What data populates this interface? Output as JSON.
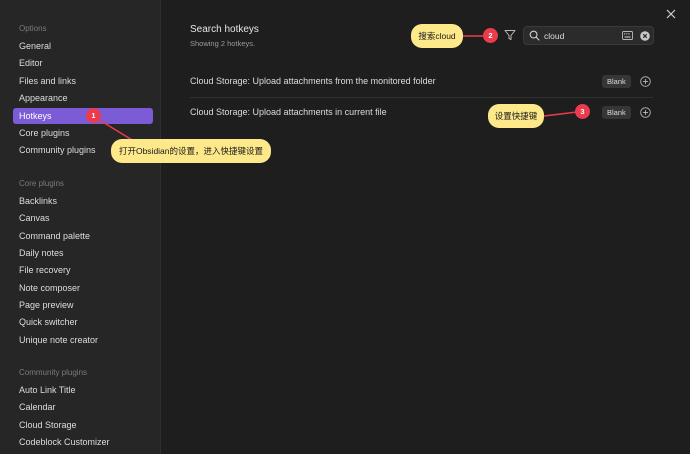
{
  "sidebar": {
    "sections": [
      {
        "title": "Options",
        "items": [
          "General",
          "Editor",
          "Files and links",
          "Appearance",
          "Hotkeys",
          "Core plugins",
          "Community plugins"
        ]
      },
      {
        "title": "Core plugins",
        "items": [
          "Backlinks",
          "Canvas",
          "Command palette",
          "Daily notes",
          "File recovery",
          "Note composer",
          "Page preview",
          "Quick switcher",
          "Unique note creator"
        ]
      },
      {
        "title": "Community plugins",
        "items": [
          "Auto Link Title",
          "Calendar",
          "Cloud Storage",
          "Codeblock Customizer"
        ]
      }
    ],
    "active_item": "Hotkeys"
  },
  "main": {
    "title": "Search hotkeys",
    "subtitle": "Showing 2 hotkeys.",
    "search": {
      "value": "cloud"
    },
    "rows": [
      {
        "label": "Cloud Storage: Upload attachments from the monitored folder",
        "hotkey": "Blank"
      },
      {
        "label": "Cloud Storage: Upload attachments in current file",
        "hotkey": "Blank"
      }
    ]
  },
  "annotations": {
    "callout1": "打开Obsidian的设置，进入快捷键设置",
    "callout2": "搜索cloud",
    "callout3": "设置快捷键",
    "marker1": "1",
    "marker2": "2",
    "marker3": "3"
  },
  "colors": {
    "accent": "#7b5cd6",
    "callout": "#fde88a",
    "marker": "#ec3b4d"
  }
}
